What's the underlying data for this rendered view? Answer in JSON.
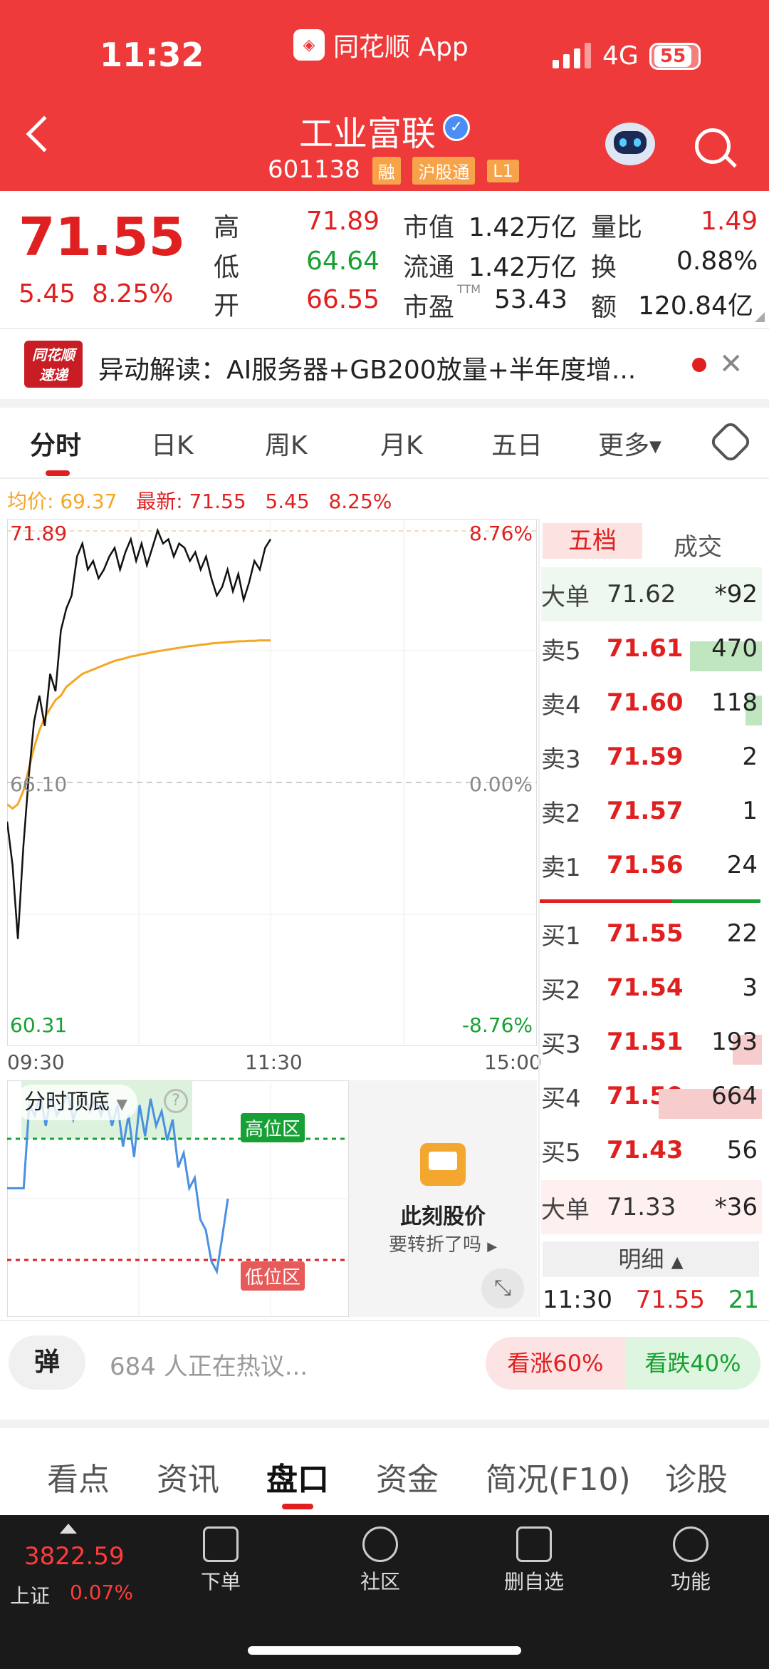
{
  "status": {
    "time": "11:32",
    "app_name": "同花顺 App",
    "network": "4G",
    "battery": "55"
  },
  "stock": {
    "name": "工业富联",
    "code": "601138",
    "tags": [
      "融",
      "沪股通",
      "L1"
    ]
  },
  "quote": {
    "price": "71.55",
    "change": "5.45",
    "change_pct": "8.25%",
    "high_label": "高",
    "high": "71.89",
    "low_label": "低",
    "low": "64.64",
    "open_label": "开",
    "open": "66.55",
    "mktcap_label": "市值",
    "mktcap": "1.42万亿",
    "float_label": "流通",
    "float": "1.42万亿",
    "pe_label": "市盈",
    "pe_sup": "TTM",
    "pe": "53.43",
    "volratio_label": "量比",
    "volratio": "1.49",
    "turnover_label": "换",
    "turnover": "0.88%",
    "amount_label": "额",
    "amount": "120.84亿"
  },
  "news": {
    "logo_top": "同花顺",
    "logo_bottom": "速递",
    "text": "异动解读：AI服务器+GB200放量+半年度增..."
  },
  "tabs": [
    "分时",
    "日K",
    "周K",
    "月K",
    "五日",
    "更多"
  ],
  "legend": {
    "avg": "均价: 69.37",
    "latest": "最新: 71.55",
    "chg": "5.45",
    "pct": "8.25%"
  },
  "chart_data": {
    "type": "line",
    "yaxis_left": [
      "71.89",
      "66.10",
      "60.31"
    ],
    "yaxis_right": [
      "8.76%",
      "0.00%",
      "-8.76%"
    ],
    "xaxis": [
      "09:30",
      "11:30",
      "15:00"
    ],
    "ylim": [
      60.31,
      71.89
    ],
    "series": [
      {
        "values": [
          65.2,
          64.2,
          62.5,
          64.6,
          66.2,
          67.5,
          68.1,
          67.4,
          68.6,
          68.2,
          69.6,
          70.1,
          70.4,
          71.3,
          71.6,
          71.0,
          71.2,
          70.8,
          71.0,
          71.3,
          71.5,
          71.0,
          71.4,
          71.7,
          71.2,
          71.6,
          71.1,
          71.5,
          71.9,
          71.6,
          71.7,
          71.3,
          71.6,
          71.5,
          71.2,
          71.4,
          71.0,
          71.3,
          70.8,
          70.4,
          70.6,
          71.0,
          70.5,
          70.9,
          70.3,
          70.7,
          71.2,
          71.0,
          71.5,
          71.7
        ]
      },
      {
        "values": [
          65.6,
          65.5,
          65.6,
          65.9,
          66.4,
          66.9,
          67.3,
          67.6,
          67.8,
          68.0,
          68.1,
          68.3,
          68.4,
          68.5,
          68.6,
          68.65,
          68.7,
          68.75,
          68.8,
          68.85,
          68.9,
          68.93,
          68.96,
          69.0,
          69.02,
          69.05,
          69.07,
          69.1,
          69.12,
          69.14,
          69.16,
          69.18,
          69.2,
          69.22,
          69.24,
          69.25,
          69.27,
          69.28,
          69.3,
          69.31,
          69.32,
          69.33,
          69.34,
          69.35,
          69.35,
          69.36,
          69.36,
          69.37,
          69.37,
          69.37
        ]
      }
    ]
  },
  "indicator": {
    "name": "分时顶底",
    "high_zone": "高位区",
    "low_zone": "低位区",
    "values": [
      0.55,
      0.55,
      0.55,
      0.55,
      0.95,
      0.9,
      1.0,
      0.85,
      1.0,
      0.9,
      0.95,
      1.0,
      0.88,
      0.96,
      1.0,
      0.92,
      0.98,
      0.9,
      0.97,
      0.85,
      0.95,
      0.75,
      0.9,
      0.7,
      0.95,
      0.8,
      0.98,
      0.85,
      0.92,
      0.78,
      0.88,
      0.65,
      0.72,
      0.55,
      0.6,
      0.4,
      0.35,
      0.2,
      0.15,
      0.32,
      0.5
    ]
  },
  "promo": {
    "title": "此刻股价",
    "sub": "要转折了吗"
  },
  "orderbook": {
    "tab_active": "五档",
    "tab_other": "成交",
    "big_sell": {
      "label": "大单",
      "price": "71.62",
      "vol": "*92"
    },
    "asks": [
      {
        "label": "卖5",
        "price": "71.61",
        "vol": "470",
        "share": 0.35
      },
      {
        "label": "卖4",
        "price": "71.60",
        "vol": "118",
        "share": 0.08
      },
      {
        "label": "卖3",
        "price": "71.59",
        "vol": "2",
        "share": 0
      },
      {
        "label": "卖2",
        "price": "71.57",
        "vol": "1",
        "share": 0
      },
      {
        "label": "卖1",
        "price": "71.56",
        "vol": "24",
        "share": 0
      }
    ],
    "bids": [
      {
        "label": "买1",
        "price": "71.55",
        "vol": "22",
        "share": 0
      },
      {
        "label": "买2",
        "price": "71.54",
        "vol": "3",
        "share": 0
      },
      {
        "label": "买3",
        "price": "71.51",
        "vol": "193",
        "share": 0.14
      },
      {
        "label": "买4",
        "price": "71.50",
        "vol": "664",
        "share": 0.5
      },
      {
        "label": "买5",
        "price": "71.43",
        "vol": "56",
        "share": 0
      }
    ],
    "big_buy": {
      "label": "大单",
      "price": "71.33",
      "vol": "*36"
    },
    "detail_label": "明细",
    "tick": {
      "time": "11:30",
      "price": "71.55",
      "vol": "21"
    }
  },
  "social": {
    "badge": "弹",
    "text": "684 人正在热议...",
    "up": "看涨60%",
    "down": "看跌40%"
  },
  "subnav": [
    "看点",
    "资讯",
    "盘口",
    "资金",
    "简况(F10)",
    "诊股"
  ],
  "dock": {
    "index_value": "3822.59",
    "index_name": "上证",
    "index_pct": "0.07%",
    "items": [
      "下单",
      "社区",
      "删自选",
      "功能"
    ]
  }
}
